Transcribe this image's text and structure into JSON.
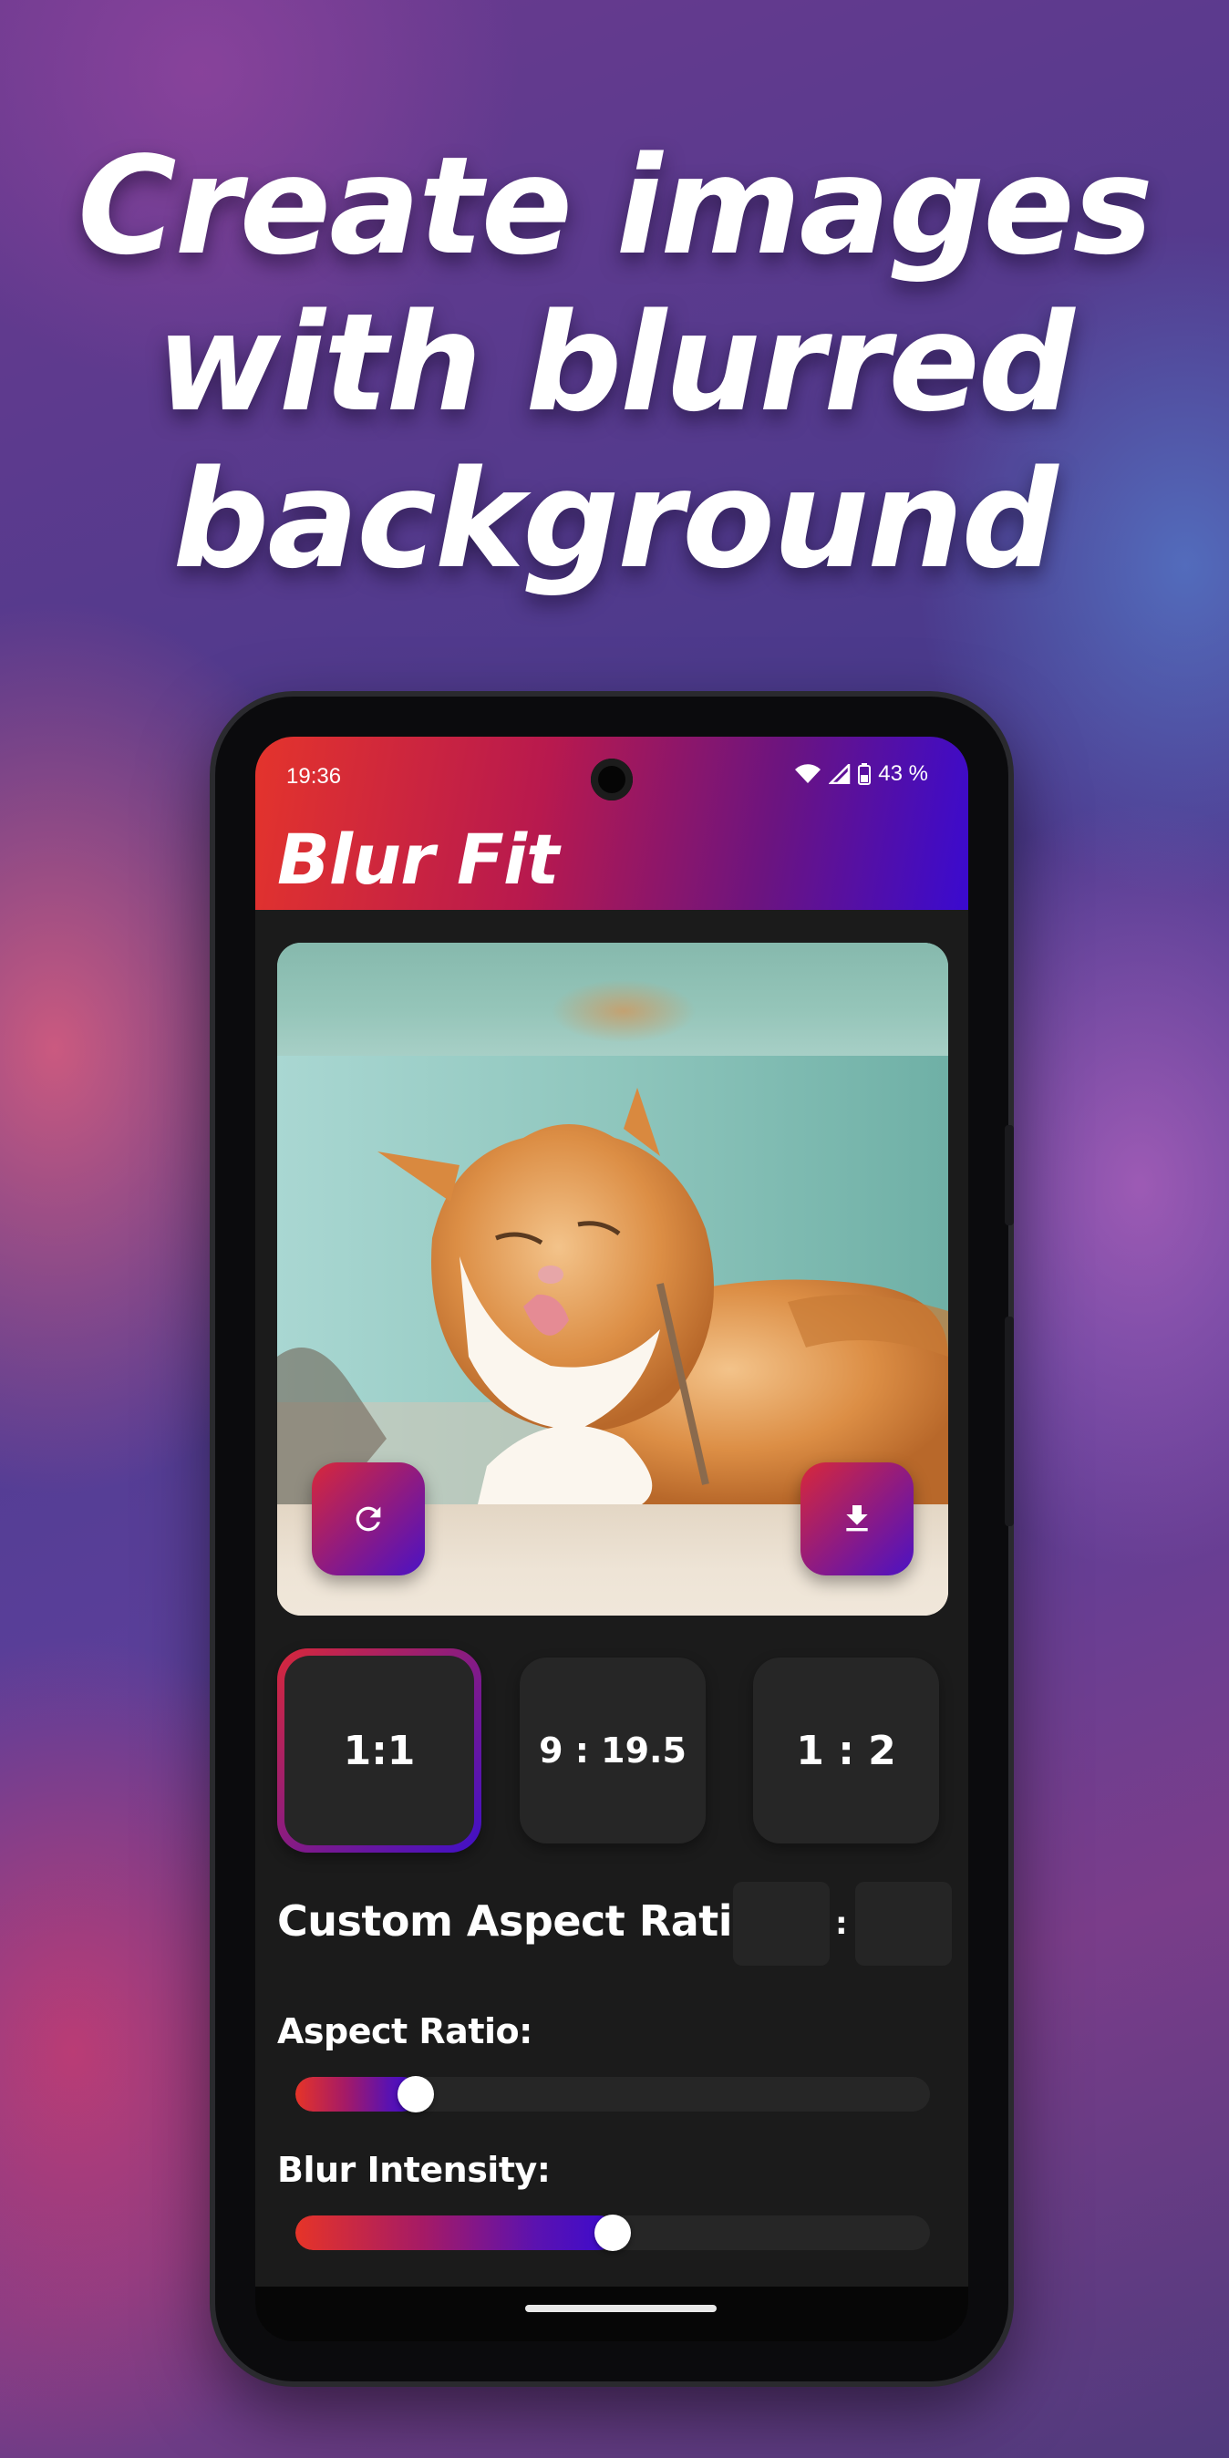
{
  "headline": {
    "line1": "Create images",
    "line2": "with blurred",
    "line3": "background"
  },
  "status_bar": {
    "time": "19:36",
    "battery": "43 %",
    "icons": [
      "wifi-icon",
      "signal-icon",
      "battery-icon"
    ]
  },
  "app": {
    "title": "Blur Fit",
    "accent_colors": [
      "#e4342c",
      "#b8194e",
      "#6b1480",
      "#3a0ad0"
    ]
  },
  "preview": {
    "reset_icon": "refresh-icon",
    "save_icon": "download-icon"
  },
  "aspect_presets": [
    {
      "label": "1:1",
      "selected": true
    },
    {
      "label": "9 : 19.5",
      "selected": false
    },
    {
      "label": "1 : 2",
      "selected": false
    }
  ],
  "custom_ratio": {
    "label": "Custom Aspect Ratio:",
    "width_value": "",
    "height_value": "",
    "separator": ":"
  },
  "sliders": {
    "aspect_ratio": {
      "label": "Aspect Ratio:",
      "value": 0.19
    },
    "blur_intensity": {
      "label": "Blur Intensity:",
      "value": 0.5
    }
  }
}
